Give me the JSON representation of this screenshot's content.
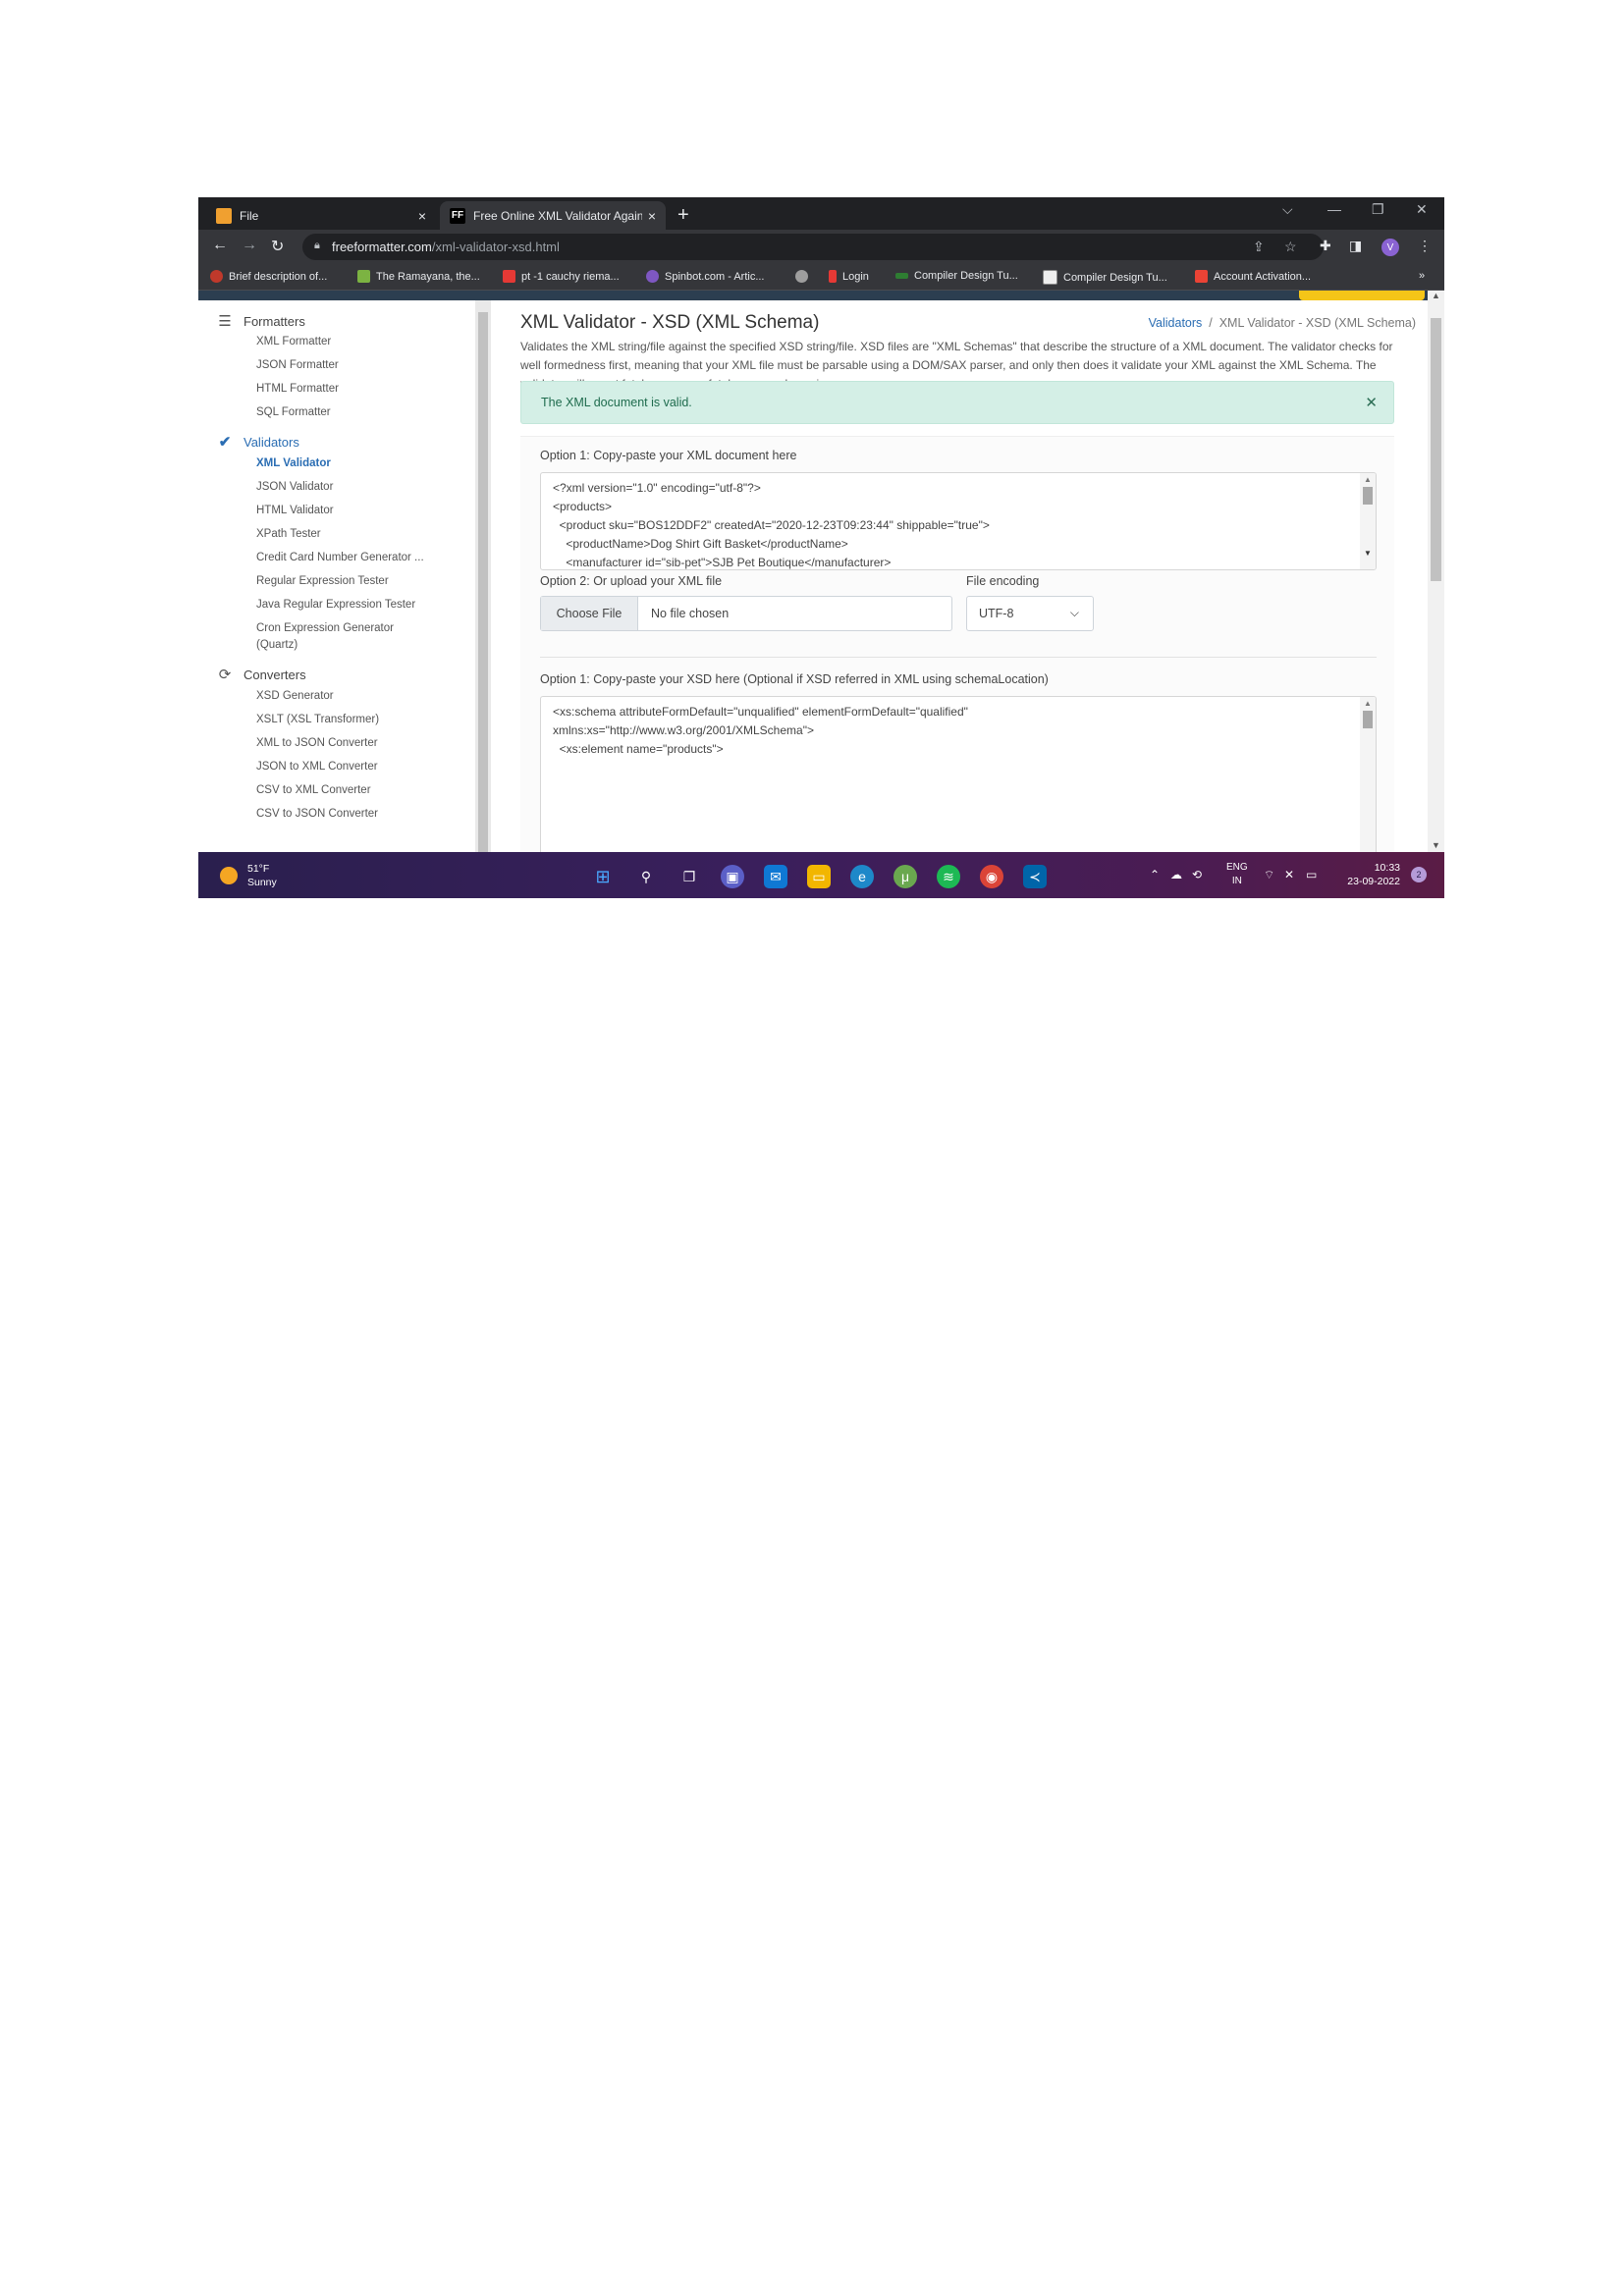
{
  "browser": {
    "tabs": [
      {
        "favicon": "file-favicon",
        "title": "File",
        "close": "×"
      },
      {
        "favicon": "FF",
        "title": "Free Online XML Validator Again",
        "close": "×"
      }
    ],
    "new_tab": "+",
    "url_host": "freeformatter.com",
    "url_path": "/xml-validator-xsd.html",
    "bookmarks": [
      "Brief description of...",
      "The Ramayana, the...",
      "pt -1 cauchy riema...",
      "Spinbot.com - Artic...",
      "",
      "Login",
      "Compiler Design Tu...",
      "Compiler Design Tu...",
      "Account Activation..."
    ],
    "bookmarks_more": "»",
    "profile_initial": "V"
  },
  "sidebar": {
    "sections": [
      {
        "label": "Formatters",
        "icon": "indent-icon",
        "items": [
          "XML Formatter",
          "JSON Formatter",
          "HTML Formatter",
          "SQL Formatter"
        ]
      },
      {
        "label": "Validators",
        "icon": "check-icon",
        "items": [
          "XML Validator",
          "JSON Validator",
          "HTML Validator",
          "XPath Tester",
          "Credit Card Number Generator ...",
          "Regular Expression Tester",
          "Java Regular Expression Tester",
          "Cron Expression Generator",
          "(Quartz)"
        ]
      },
      {
        "label": "Converters",
        "icon": "refresh-icon",
        "items": [
          "XSD Generator",
          "XSLT (XSL Transformer)",
          "XML to JSON Converter",
          "JSON to XML Converter",
          "CSV to XML Converter",
          "CSV to JSON Converter"
        ]
      }
    ]
  },
  "main": {
    "title": "XML Validator - XSD (XML Schema)",
    "breadcrumb": {
      "link": "Validators",
      "separator": "/",
      "current": "XML Validator - XSD (XML Schema)"
    },
    "description": "Validates the XML string/file against the specified XSD string/file. XSD files are \"XML Schemas\" that describe the structure of a XML document. The validator checks for well formedness first, meaning that your XML file must be parsable using a DOM/SAX parser, and only then does it validate your XML against the XML Schema. The validator will report fatal errors, non-fatal errors and warnings.",
    "alert": "The XML document is valid.",
    "xml_label": "Option 1: Copy-paste your XML document here",
    "xml_lines": [
      "<?xml version=\"1.0\" encoding=\"utf-8\"?>",
      "<products>",
      "  <product sku=\"BOS12DDF2\" createdAt=\"2020-12-23T09:23:44\" shippable=\"true\">",
      "    <productName>Dog Shirt Gift Basket</productName>",
      "    <manufacturer id=\"sib-pet\">SJB Pet Boutique</manufacturer>"
    ],
    "upload_label": "Option 2: Or upload your XML file",
    "choose_file": "Choose File",
    "no_file": "No file chosen",
    "encoding_label": "File encoding",
    "encoding_value": "UTF-8",
    "xsd_label": "Option 1: Copy-paste your XSD here (Optional if XSD referred in XML using schemaLocation)",
    "xsd_lines": [
      "<xs:schema attributeFormDefault=\"unqualified\" elementFormDefault=\"qualified\"",
      "xmlns:xs=\"http://www.w3.org/2001/XMLSchema\">",
      "  <xs:element name=\"products\">"
    ]
  },
  "taskbar": {
    "temperature": "51°F",
    "condition": "Sunny",
    "lang": "ENG",
    "region": "IN",
    "time": "10:33",
    "date": "23-09-2022",
    "notifications": "2"
  },
  "colors": {
    "accent": "#2a6db3",
    "alert_bg": "#d4efe6",
    "alert_text": "#1e6b4d",
    "chrome_dark": "#202124"
  }
}
